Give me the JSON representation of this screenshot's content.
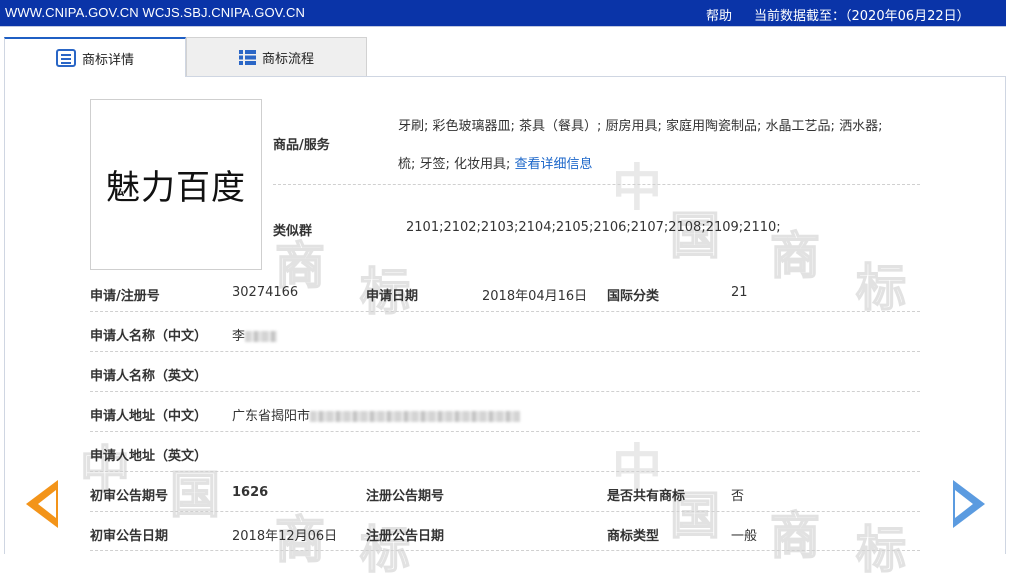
{
  "topbar": {
    "urls": "WWW.CNIPA.GOV.CN WCJS.SBJ.CNIPA.GOV.CN",
    "help": "帮助",
    "as_of": "当前数据截至：（2020年06月22日）"
  },
  "tabs": [
    {
      "label": "商标详情",
      "icon": "document-list-icon",
      "active": true
    },
    {
      "label": "商标流程",
      "icon": "list-icon",
      "active": false
    }
  ],
  "watermark_text": [
    "中",
    "国",
    "商",
    "标"
  ],
  "trademark": {
    "image_text": "魅力百度",
    "goods_label": "商品/服务",
    "goods_line1": "牙刷; 彩色玻璃器皿; 茶具（餐具）; 厨房用具; 家庭用陶瓷制品; 水晶工艺品; 洒水器;",
    "goods_line2": "梳; 牙签; 化妆用具;",
    "goods_link": "查看详细信息",
    "similar_label": "类似群",
    "similar_value": "2101;2102;2103;2104;2105;2106;2107;2108;2109;2110;",
    "reg_no_label": "申请/注册号",
    "reg_no": "30274166",
    "app_date_label": "申请日期",
    "app_date": "2018年04月16日",
    "intl_class_label": "国际分类",
    "intl_class": "21",
    "applicant_cn_label": "申请人名称（中文）",
    "applicant_cn": "李",
    "applicant_en_label": "申请人名称（英文）",
    "address_cn_label": "申请人地址（中文）",
    "address_cn": "广东省揭阳市",
    "address_en_label": "申请人地址（英文）",
    "prelim_pub_no_label": "初审公告期号",
    "prelim_pub_no": "1626",
    "reg_pub_no_label": "注册公告期号",
    "shared_label": "是否共有商标",
    "shared": "否",
    "prelim_pub_date_label": "初审公告日期",
    "prelim_pub_date": "2018年12月06日",
    "reg_pub_date_label": "注册公告日期",
    "type_label": "商标类型",
    "type": "一般"
  },
  "nav": {
    "prev_icon": "arrow-left-icon",
    "next_icon": "arrow-right-icon"
  },
  "colors": {
    "topbar": "#0a34a8",
    "prev_arrow": "#f39419",
    "next_arrow": "#5b9be0",
    "link": "#1b66c9"
  }
}
